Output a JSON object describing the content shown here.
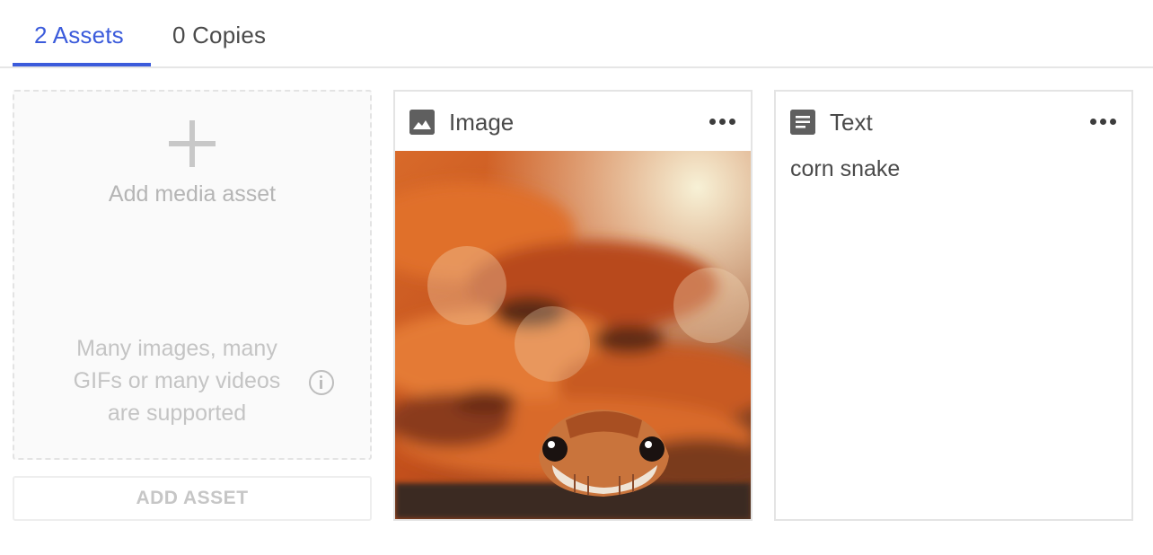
{
  "tabs": {
    "assets_label": "2 Assets",
    "copies_label": "0 Copies"
  },
  "add_tile": {
    "icon": "plus-icon",
    "label": "Add media asset",
    "support_line1": "Many images, many",
    "support_line2": "GIFs or many videos",
    "support_line3": "are supported",
    "info_icon": "info-icon"
  },
  "add_asset_button": "ADD ASSET",
  "cards": [
    {
      "type_label": "Image",
      "icon": "image-icon",
      "menu_icon": "more-horizontal-icon",
      "image": "corn snake photo"
    },
    {
      "type_label": "Text",
      "icon": "document-icon",
      "menu_icon": "more-horizontal-icon",
      "content": "corn snake"
    }
  ],
  "colors": {
    "accent": "#3b5bdb",
    "icon": "#5f5f5f",
    "muted": "#c4c4c4"
  }
}
